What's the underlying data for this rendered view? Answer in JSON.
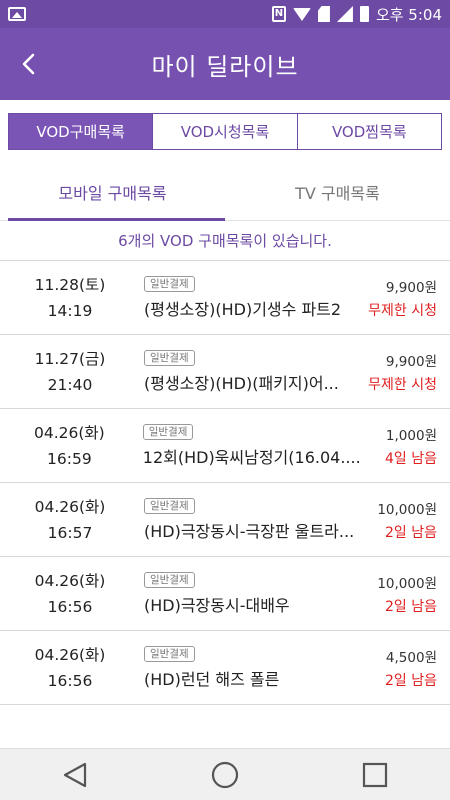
{
  "status_bar": {
    "time": "오후 5:04"
  },
  "header": {
    "title": "마이 딜라이브"
  },
  "segments": [
    {
      "label": "VOD구매목록",
      "active": true
    },
    {
      "label": "VOD시청목록",
      "active": false
    },
    {
      "label": "VOD찜목록",
      "active": false
    }
  ],
  "subtabs": [
    {
      "label": "모바일 구매목록",
      "active": true
    },
    {
      "label": "TV 구매목록",
      "active": false
    }
  ],
  "summary": "6개의 VOD 구매목록이 있습니다.",
  "items": [
    {
      "date": "11.28(토)",
      "time": "14:19",
      "badge": "일반결제",
      "title": "(평생소장)(HD)기생수 파트2",
      "price": "9,900원",
      "status": "무제한 시청"
    },
    {
      "date": "11.27(금)",
      "time": "21:40",
      "badge": "일반결제",
      "title": "(평생소장)(HD)(패키지)어...",
      "price": "9,900원",
      "status": "무제한 시청"
    },
    {
      "date": "04.26(화)",
      "time": "16:59",
      "badge": "일반결제",
      "title": "12회(HD)욱씨남정기(16.04....",
      "price": "1,000원",
      "status": "4일 남음"
    },
    {
      "date": "04.26(화)",
      "time": "16:57",
      "badge": "일반결제",
      "title": "(HD)극장동시-극장판 울트라...",
      "price": "10,000원",
      "status": "2일 남음"
    },
    {
      "date": "04.26(화)",
      "time": "16:56",
      "badge": "일반결제",
      "title": "(HD)극장동시-대배우",
      "price": "10,000원",
      "status": "2일 남음"
    },
    {
      "date": "04.26(화)",
      "time": "16:56",
      "badge": "일반결제",
      "title": "(HD)런던 해즈 폴른",
      "price": "4,500원",
      "status": "2일 남음"
    }
  ],
  "colors": {
    "accent": "#7651b0",
    "status_red": "#e02020"
  },
  "nav_icons": [
    "back-triangle-icon",
    "home-circle-icon",
    "recents-square-icon"
  ]
}
